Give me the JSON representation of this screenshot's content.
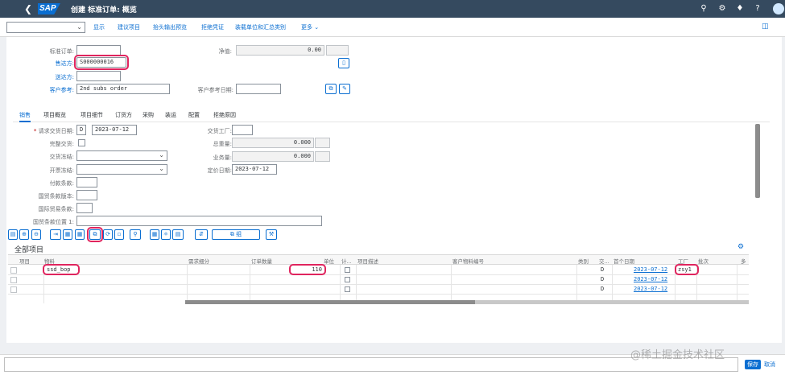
{
  "shell": {
    "title": "创建 标准订单: 概览",
    "logo": "SAP"
  },
  "toolbar": {
    "buttons": [
      "显示",
      "建议项目",
      "抬头输出预览",
      "拒绝凭证",
      "装载单位和汇总类别",
      "更多"
    ],
    "more_chevron": "chevron-down-icon"
  },
  "header": {
    "order_type_label": "标准订单:",
    "sold_to_label": "售达方:",
    "sold_to_value": "S000000016",
    "ship_to_label": "送达方:",
    "customer_ref_label": "客户参考:",
    "customer_ref_value": "2nd subs order",
    "net_value_label": "净值:",
    "net_value": "0.00",
    "customer_ref_date_label": "客户参考日期:"
  },
  "tabs": [
    "销售",
    "项目概览",
    "项目细节",
    "订货方",
    "采购",
    "装运",
    "配置",
    "拒绝原因"
  ],
  "sales": {
    "req_delivery_date_label": "请求交货日期:",
    "req_delivery_date_unit": "D",
    "req_delivery_date": "2023-07-12",
    "complete_delivery_label": "完整交货:",
    "delivery_block_label": "交货冻结:",
    "billing_block_label": "开票冻结:",
    "payment_terms_label": "付款条款:",
    "incoterms_version_label": "国贸条款版本:",
    "incoterms_label": "国际贸易条款:",
    "incoterms_location_label": "国贸条款位置 1:",
    "delivering_plant_label": "交货工厂:",
    "total_weight_label": "总重量:",
    "total_weight": "0.000",
    "volume_label": "业务量:",
    "volume": "0.000",
    "pricing_date_label": "定价日期:",
    "pricing_date": "2023-07-12"
  },
  "items_toolbar": {
    "group_label": "组"
  },
  "items": {
    "title": "全部项目",
    "columns": [
      "项目",
      "物料",
      "需求细分",
      "订单数量",
      "单位",
      "计...",
      "项目描述",
      "客户物料编号",
      "类别",
      "交...",
      "首个日期",
      "工厂",
      "批次",
      "多"
    ],
    "rows": [
      {
        "material": "ssd_bop",
        "quantity": "110",
        "d": "D",
        "date": "2023-07-12",
        "plant": "zsy1"
      },
      {
        "material": "",
        "quantity": "",
        "d": "D",
        "date": "2023-07-12",
        "plant": ""
      },
      {
        "material": "",
        "quantity": "",
        "d": "D",
        "date": "2023-07-12",
        "plant": ""
      }
    ]
  },
  "footer": {
    "save": "保存",
    "cancel": "取消"
  },
  "watermark": "@稀土掘金技术社区",
  "colors": {
    "shell": "#354a5f",
    "accent": "#0a6ed1",
    "highlight": "#e0245e"
  }
}
